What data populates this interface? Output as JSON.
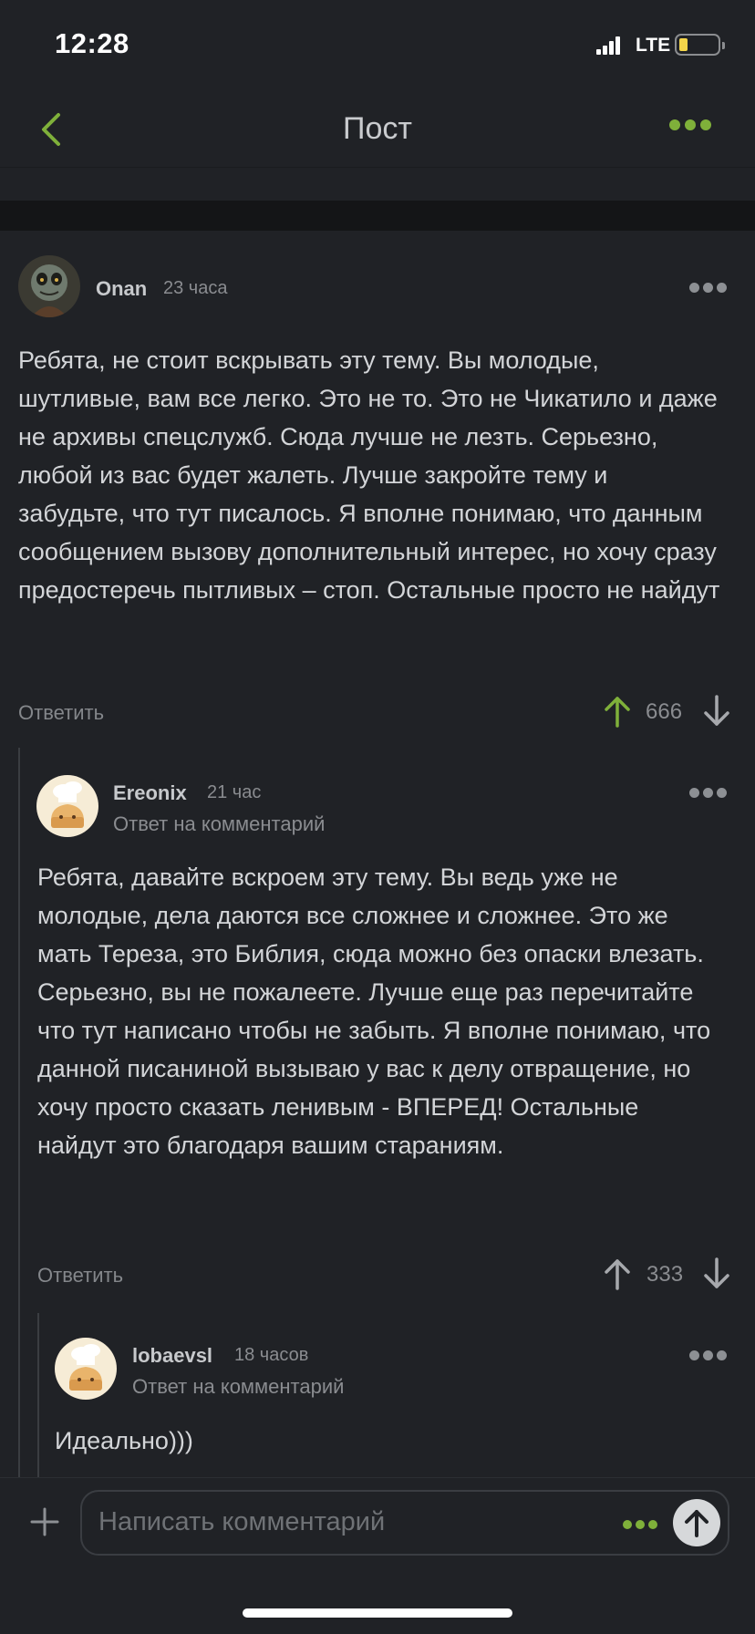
{
  "status_bar": {
    "time": "12:28",
    "network": "LTE"
  },
  "nav": {
    "title": "Пост",
    "back_icon": "chevron-left-icon",
    "more_icon": "ellipsis-icon"
  },
  "colors": {
    "accent": "#7fb03a",
    "background": "#202226",
    "upvote_active": "#7fb03a"
  },
  "comments": [
    {
      "username": "Onan",
      "time": "23 часа",
      "text": "Ребята, не стоит вскрывать эту тему. Вы молодые, шутливые, вам все легко. Это не то. Это не Чикатило и даже не архивы спецслужб. Сюда лучше не лезть. Серьезно, любой из вас будет жалеть. Лучше закройте тему и забудьте, что тут писалось. Я вполне понимаю, что данным сообщением вызову дополнительный интерес, но хочу сразу предостеречь пытливых – стоп. Остальные просто не найдут",
      "reply_label": "Ответить",
      "votes": "666"
    },
    {
      "username": "Ereonix",
      "time": "21 час",
      "reply_to": "Ответ на комментарий",
      "text": "Ребята, давайте вскроем эту тему. Вы ведь уже не молодые, дела даются все сложнее и сложнее. Это же мать Тереза, это Библия, сюда можно без опаски влезать. Серьезно, вы не пожалеете. Лучше еще раз перечитайте что тут написано чтобы не забыть. Я вполне понимаю, что данной писаниной вызываю у вас к делу отвращение, но хочу просто сказать ленивым - ВПЕРЕД! Остальные найдут это благодаря вашим стараниям.",
      "reply_label": "Ответить",
      "votes": "333"
    },
    {
      "username": "lobaevsl",
      "time": "18 часов",
      "reply_to": "Ответ на комментарий",
      "text": "Идеально)))"
    }
  ],
  "composer": {
    "placeholder": "Написать комментарий",
    "plus_icon": "plus-icon",
    "send_icon": "arrow-up-icon"
  }
}
